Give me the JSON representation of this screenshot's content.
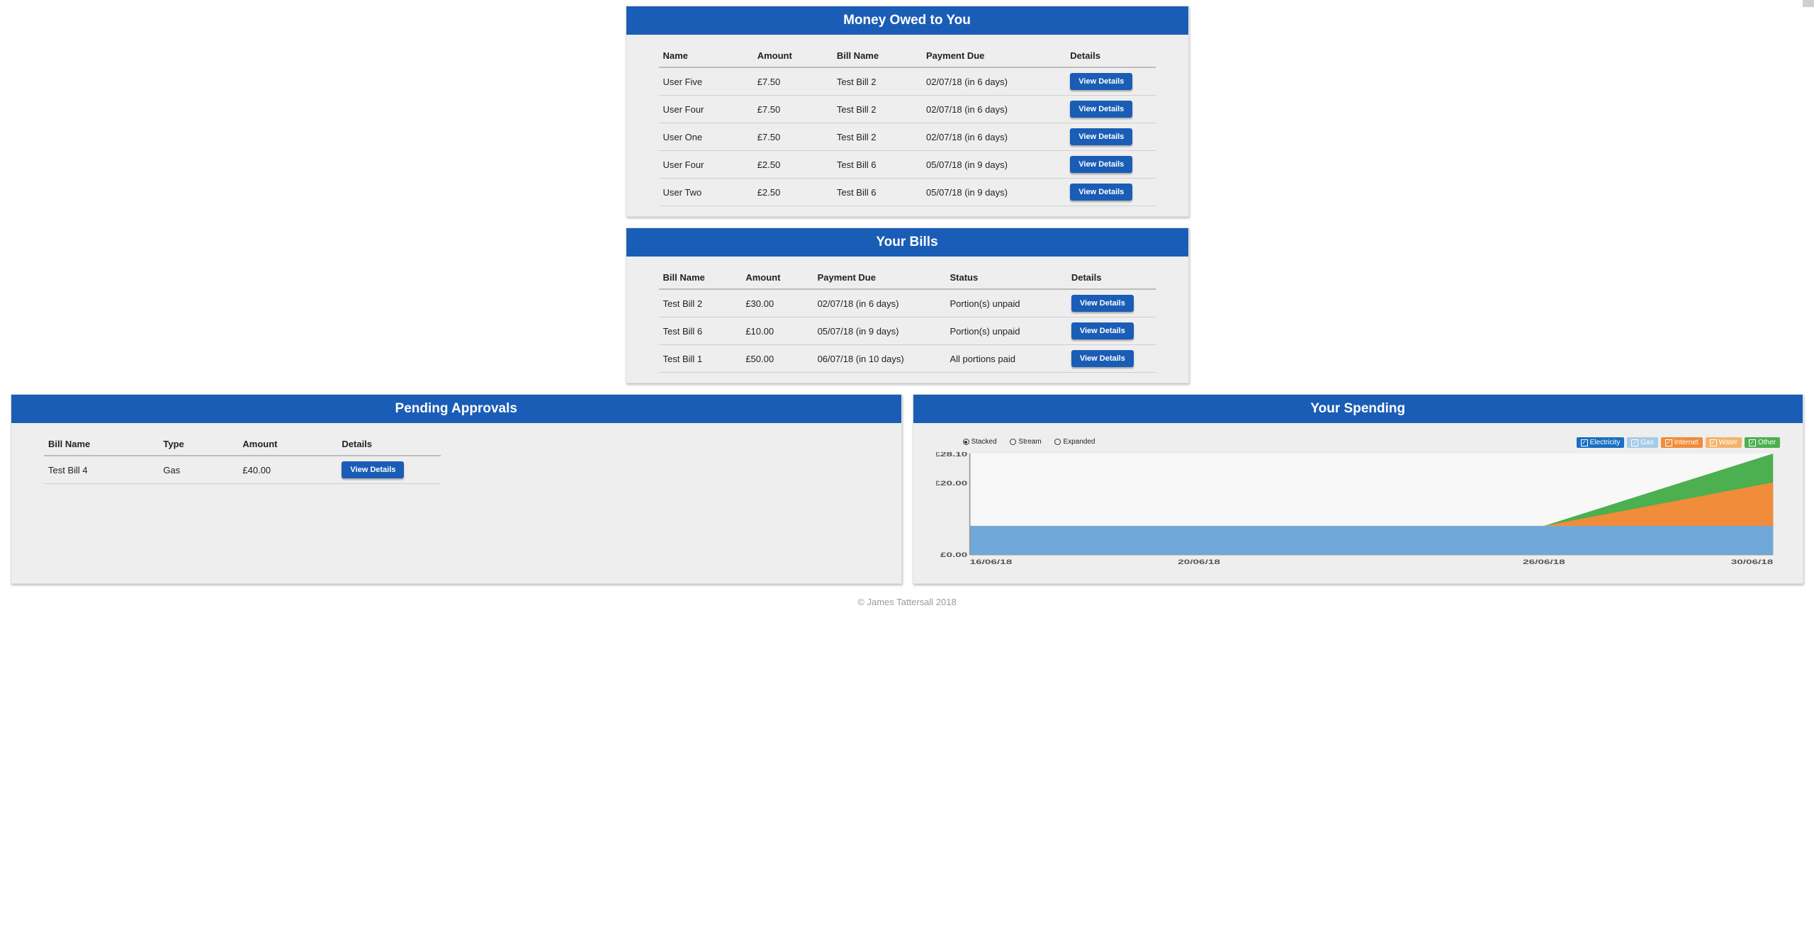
{
  "panels": {
    "owed": {
      "title": "Money Owed to You",
      "headers": [
        "Name",
        "Amount",
        "Bill Name",
        "Payment Due",
        "Details"
      ],
      "rows": [
        {
          "name": "User Five",
          "amount": "£7.50",
          "bill": "Test Bill 2",
          "due": "02/07/18 (in 6 days)",
          "btn": "View Details"
        },
        {
          "name": "User Four",
          "amount": "£7.50",
          "bill": "Test Bill 2",
          "due": "02/07/18 (in 6 days)",
          "btn": "View Details"
        },
        {
          "name": "User One",
          "amount": "£7.50",
          "bill": "Test Bill 2",
          "due": "02/07/18 (in 6 days)",
          "btn": "View Details"
        },
        {
          "name": "User Four",
          "amount": "£2.50",
          "bill": "Test Bill 6",
          "due": "05/07/18 (in 9 days)",
          "btn": "View Details"
        },
        {
          "name": "User Two",
          "amount": "£2.50",
          "bill": "Test Bill 6",
          "due": "05/07/18 (in 9 days)",
          "btn": "View Details"
        }
      ]
    },
    "bills": {
      "title": "Your Bills",
      "headers": [
        "Bill Name",
        "Amount",
        "Payment Due",
        "Status",
        "Details"
      ],
      "rows": [
        {
          "bill": "Test Bill 2",
          "amount": "£30.00",
          "due": "02/07/18 (in 6 days)",
          "status": "Portion(s) unpaid",
          "btn": "View Details"
        },
        {
          "bill": "Test Bill 6",
          "amount": "£10.00",
          "due": "05/07/18 (in 9 days)",
          "status": "Portion(s) unpaid",
          "btn": "View Details"
        },
        {
          "bill": "Test Bill 1",
          "amount": "£50.00",
          "due": "06/07/18 (in 10 days)",
          "status": "All portions paid",
          "btn": "View Details"
        }
      ]
    },
    "approvals": {
      "title": "Pending Approvals",
      "headers": [
        "Bill Name",
        "Type",
        "Amount",
        "Details"
      ],
      "rows": [
        {
          "bill": "Test Bill 4",
          "type": "Gas",
          "amount": "£40.00",
          "btn": "View Details"
        }
      ]
    },
    "spending": {
      "title": "Your Spending",
      "modes": {
        "stacked": "Stacked",
        "stream": "Stream",
        "expanded": "Expanded",
        "selected": "stacked"
      },
      "legend": [
        {
          "label": "Electricity",
          "color": "#1a6fc2"
        },
        {
          "label": "Gas",
          "color": "#a6cbe8"
        },
        {
          "label": "Internet",
          "color": "#f08c3a"
        },
        {
          "label": "Water",
          "color": "#f6b26b"
        },
        {
          "label": "Other",
          "color": "#4CAF50"
        }
      ],
      "y_ticks": [
        "£28.10",
        "£20.00",
        "£0.00"
      ],
      "x_ticks": [
        "16/06/18",
        "20/06/18",
        "26/06/18",
        "30/06/18"
      ]
    }
  },
  "footer": "© James Tattersall 2018",
  "chart_data": {
    "type": "area",
    "stacked": true,
    "xlabel": "",
    "ylabel": "",
    "x": [
      "16/06/18",
      "20/06/18",
      "26/06/18",
      "30/06/18"
    ],
    "ylim": [
      0,
      28.1
    ],
    "series": [
      {
        "name": "Electricity",
        "color": "#1a6fc2",
        "values": [
          8.0,
          8.0,
          8.0,
          8.0
        ]
      },
      {
        "name": "Gas",
        "color": "#a6cbe8",
        "values": [
          0,
          0,
          0,
          0
        ]
      },
      {
        "name": "Internet",
        "color": "#f08c3a",
        "values": [
          0,
          0,
          0,
          12.1
        ]
      },
      {
        "name": "Water",
        "color": "#f6b26b",
        "values": [
          0,
          0,
          0,
          0
        ]
      },
      {
        "name": "Other",
        "color": "#4CAF50",
        "values": [
          0,
          0,
          0,
          8.0
        ]
      }
    ]
  }
}
